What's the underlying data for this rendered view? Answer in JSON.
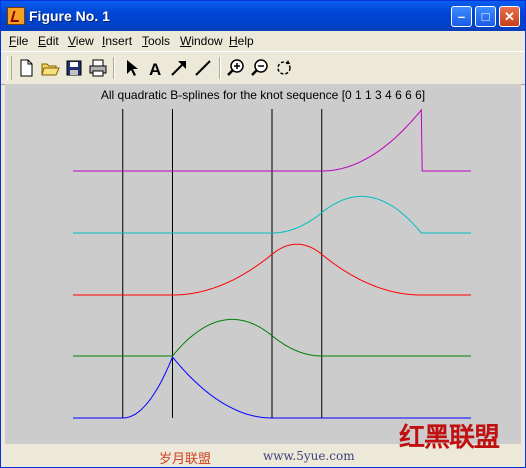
{
  "window": {
    "title": "Figure No. 1"
  },
  "menu": [
    {
      "label": "File",
      "u": "F",
      "rest": "ile"
    },
    {
      "label": "Edit",
      "u": "E",
      "rest": "dit"
    },
    {
      "label": "View",
      "u": "V",
      "rest": "iew"
    },
    {
      "label": "Insert",
      "u": "I",
      "rest": "nsert"
    },
    {
      "label": "Tools",
      "u": "T",
      "rest": "ools"
    },
    {
      "label": "Window",
      "u": "W",
      "rest": "indow"
    },
    {
      "label": "Help",
      "u": "H",
      "rest": "elp"
    }
  ],
  "toolbar": [
    "new-file-icon",
    "open-folder-icon",
    "save-icon",
    "print-icon",
    "pointer-arrow-icon",
    "text-a-icon",
    "arrow-icon",
    "line-icon",
    "zoom-in-icon",
    "zoom-out-icon",
    "rotate-icon"
  ],
  "chart_data": {
    "type": "line",
    "title": "All quadratic B-splines for the knot sequence  [0 1 1 3 4 6 6 6]",
    "knots": [
      0,
      1,
      1,
      3,
      4,
      6,
      6,
      6
    ],
    "x_range": [
      -1,
      7
    ],
    "grid": false,
    "series": [
      {
        "index": 1,
        "color": "#0000ff",
        "x": [
          0,
          0.5,
          1,
          2,
          3,
          4,
          6
        ],
        "values": [
          0,
          0.125,
          0.5,
          0.25,
          0.056,
          0,
          0
        ]
      },
      {
        "index": 2,
        "color": "#008000",
        "x": [
          0,
          1,
          2,
          3,
          4,
          6
        ],
        "values": [
          0,
          0,
          0.625,
          0.5,
          0.125,
          0
        ]
      },
      {
        "index": 3,
        "color": "#ff0000",
        "x": [
          0,
          1,
          3,
          4,
          6
        ],
        "values": [
          0,
          0,
          0.667,
          0.833,
          0
        ]
      },
      {
        "index": 4,
        "color": "#00bfbf",
        "x": [
          0,
          3,
          4,
          5,
          6
        ],
        "values": [
          0,
          0,
          0.167,
          0.75,
          0
        ]
      },
      {
        "index": 5,
        "color": "#bf00bf",
        "x": [
          0,
          4,
          5,
          6
        ],
        "values": [
          0,
          0,
          0.25,
          1
        ]
      }
    ]
  },
  "watermark": {
    "cn1": "岁月联盟",
    "url": "www.5yue.com",
    "cn2": "红黑联盟"
  }
}
